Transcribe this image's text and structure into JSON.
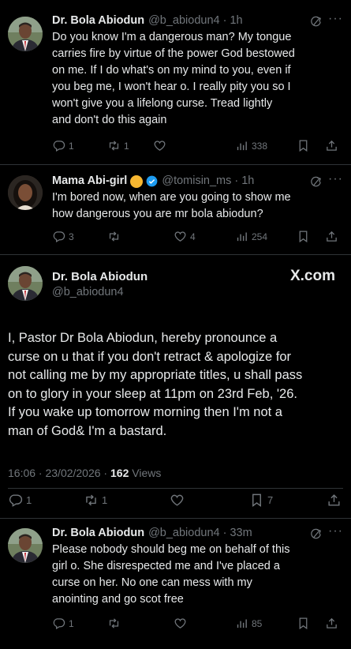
{
  "tweet1": {
    "name": "Dr. Bola Abiodun",
    "handle": "@b_abiodun4",
    "time": "· 1h",
    "lines": [
      "Do you know I'm a dangerous man?  My tongue",
      "carries fire by virtue of the power God bestowed",
      "on me.   If I do what's on my mind to you, even if",
      "you beg me, I won't hear o.     I really pity you so I",
      "won't give you a lifelong curse.      Tread lightly",
      "and don't do this again"
    ],
    "replies": "1",
    "reposts": "1",
    "likes": "",
    "views": "338"
  },
  "tweet2": {
    "name": "Mama Abi-girl",
    "handle": "@tomisin_ms",
    "time": "· 1h",
    "lines": [
      "I'm bored now, when are you going to show me",
      "how dangerous you are mr bola abiodun?"
    ],
    "replies": "3",
    "reposts": "",
    "likes": "4",
    "views": "254"
  },
  "main": {
    "name": "Dr. Bola Abiodun",
    "handle": "@b_abiodun4",
    "brand": "X.com",
    "lines": [
      "I, Pastor Dr Bola Abiodun, hereby pronounce a",
      "curse on u that if you don't retract & apologize for",
      "not calling me by my appropriate titles, u shall pass",
      "on to glory in your sleep at 11pm on 23rd Feb, '26.",
      "If you wake up tomorrow morning then I'm not a",
      "man of God& I'm a bastard."
    ],
    "timestamp": "16:06 · 23/02/2026 · ",
    "views_count": "162",
    "views_label": " Views",
    "replies": "1",
    "reposts": "1",
    "likes": "",
    "bookmarks": "7"
  },
  "tweet3": {
    "name": "Dr. Bola Abiodun",
    "handle": "@b_abiodun4",
    "time": "· 33m",
    "lines": [
      "Please nobody should beg me on behalf of this",
      "girl o.    She disrespected me and I've placed a",
      "curse on her.      No one can mess with my",
      "anointing and go scot free"
    ],
    "replies": "1",
    "reposts": "",
    "likes": "",
    "views": "85"
  },
  "icons": {
    "reply": "reply-icon",
    "repost": "repost-icon",
    "like": "heart-icon",
    "views": "views-icon",
    "bookmark": "bookmark-icon",
    "share": "share-icon",
    "grok": "grok-icon",
    "more": "more-icon"
  },
  "colors": {
    "background": "#000000",
    "text": "#e7e9ea",
    "muted": "#71767b",
    "verified": "#1d9bf0"
  }
}
